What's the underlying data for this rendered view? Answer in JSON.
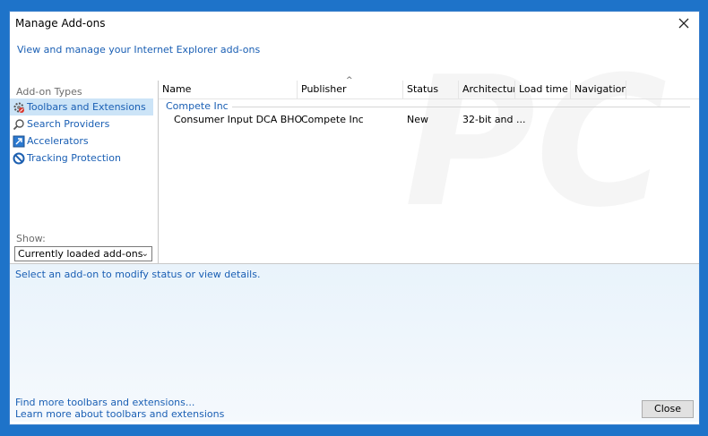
{
  "window": {
    "title": "Manage Add-ons",
    "subtitle": "View and manage your Internet Explorer add-ons"
  },
  "sidebar": {
    "section_label": "Add-on Types",
    "items": [
      {
        "label": "Toolbars and Extensions",
        "icon": "gear-icon",
        "selected": true
      },
      {
        "label": "Search Providers",
        "icon": "search-icon",
        "selected": false
      },
      {
        "label": "Accelerators",
        "icon": "accelerator-icon",
        "selected": false
      },
      {
        "label": "Tracking Protection",
        "icon": "block-icon",
        "selected": false
      }
    ],
    "show_label": "Show:",
    "show_value": "Currently loaded add-ons"
  },
  "table": {
    "columns": [
      "Name",
      "Publisher",
      "Status",
      "Architecture",
      "Load time",
      "Navigation..."
    ],
    "group": "Compete Inc",
    "rows": [
      {
        "name": "Consumer Input DCA BHO",
        "publisher": "Compete Inc",
        "status": "New",
        "architecture": "32-bit and ...",
        "load_time": "",
        "navigation": ""
      }
    ]
  },
  "details": {
    "text": "Select an add-on to modify status or view details.",
    "link1": "Find more toolbars and extensions...",
    "link2": "Learn more about toolbars and extensions"
  },
  "buttons": {
    "close": "Close"
  },
  "colors": {
    "background": "#1e73c9",
    "link": "#1a5fb4",
    "selection": "#cce4f7"
  }
}
